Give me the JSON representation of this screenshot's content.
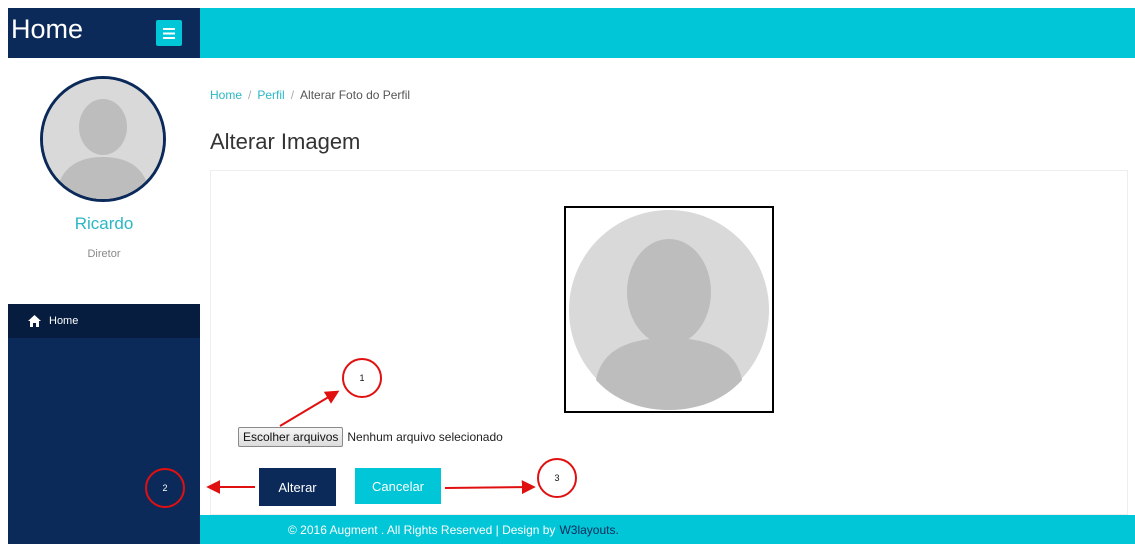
{
  "brand": {
    "title": "Home"
  },
  "profile": {
    "name": "Ricardo",
    "role": "Diretor"
  },
  "nav": {
    "home_label": "Home"
  },
  "breadcrumb": {
    "home": "Home",
    "perfil": "Perfil",
    "current": "Alterar Foto do Perfil",
    "separator": "/"
  },
  "page": {
    "title": "Alterar Imagem"
  },
  "file_input": {
    "button_label": "Escolher arquivos",
    "status": "Nenhum arquivo selecionado"
  },
  "actions": {
    "submit_label": "Alterar",
    "cancel_label": "Cancelar"
  },
  "footer": {
    "text": "© 2016 Augment . All Rights Reserved | Design by",
    "link": "W3layouts."
  },
  "annotations": {
    "marker_1": "1",
    "marker_2": "2",
    "marker_3": "3"
  },
  "icons": {
    "menu": "hamburger-menu-icon",
    "home": "home-icon",
    "avatar": "user-silhouette-icon"
  },
  "colors": {
    "navy": "#0b2a5a",
    "cyan": "#00c6d7",
    "accent_text": "#2ab7c4",
    "annotation_red": "#e01010"
  }
}
